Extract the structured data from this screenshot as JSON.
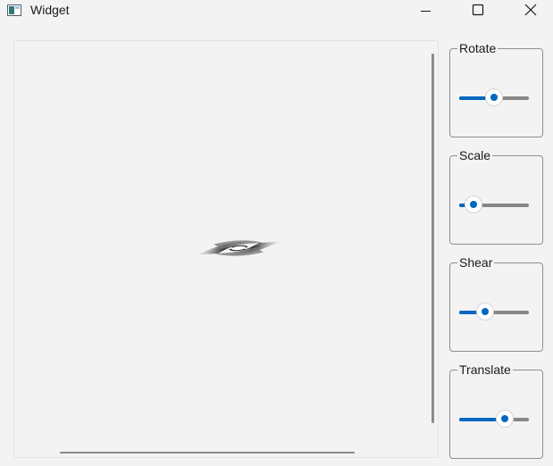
{
  "window": {
    "title": "Widget"
  },
  "icons": {
    "app": "app-window-icon",
    "minimize": "minimize-icon",
    "maximize": "maximize-icon",
    "close": "close-icon"
  },
  "colors": {
    "accent": "#0067c0",
    "track": "#868686",
    "background": "#f3f3f3"
  },
  "controls": [
    {
      "id": "rotate",
      "label": "Rotate",
      "value": 0.5
    },
    {
      "id": "scale",
      "label": "Scale",
      "value": 0.2
    },
    {
      "id": "shear",
      "label": "Shear",
      "value": 0.37
    },
    {
      "id": "translate",
      "label": "Translate",
      "value": 0.65
    }
  ]
}
